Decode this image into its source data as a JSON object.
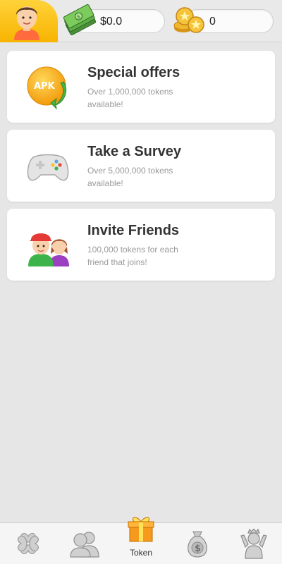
{
  "header": {
    "avatar_icon": "user-avatar-icon",
    "money_icon": "cash-stack-icon",
    "money_value": "$0.0",
    "coin_icon": "gold-coins-icon",
    "coin_value": "0",
    "accent_color": "#f7b400"
  },
  "offers": [
    {
      "title": "Special offers",
      "subtitle": "Over 1,000,000 tokens available!",
      "icon": "apk-download-icon"
    },
    {
      "title": "Take a Survey",
      "subtitle": "Over 5,000,000 tokens available!",
      "icon": "gamepad-icon"
    },
    {
      "title": "Invite Friends",
      "subtitle": "100,000 tokens for each friend that joins!",
      "icon": "friends-icon"
    }
  ],
  "bottom_nav": {
    "items": [
      {
        "icon": "clover-icon",
        "label": ""
      },
      {
        "icon": "people-icon",
        "label": ""
      },
      {
        "icon": "gift-icon",
        "label": "Token"
      },
      {
        "icon": "money-bag-icon",
        "label": ""
      },
      {
        "icon": "winner-icon",
        "label": ""
      }
    ]
  }
}
